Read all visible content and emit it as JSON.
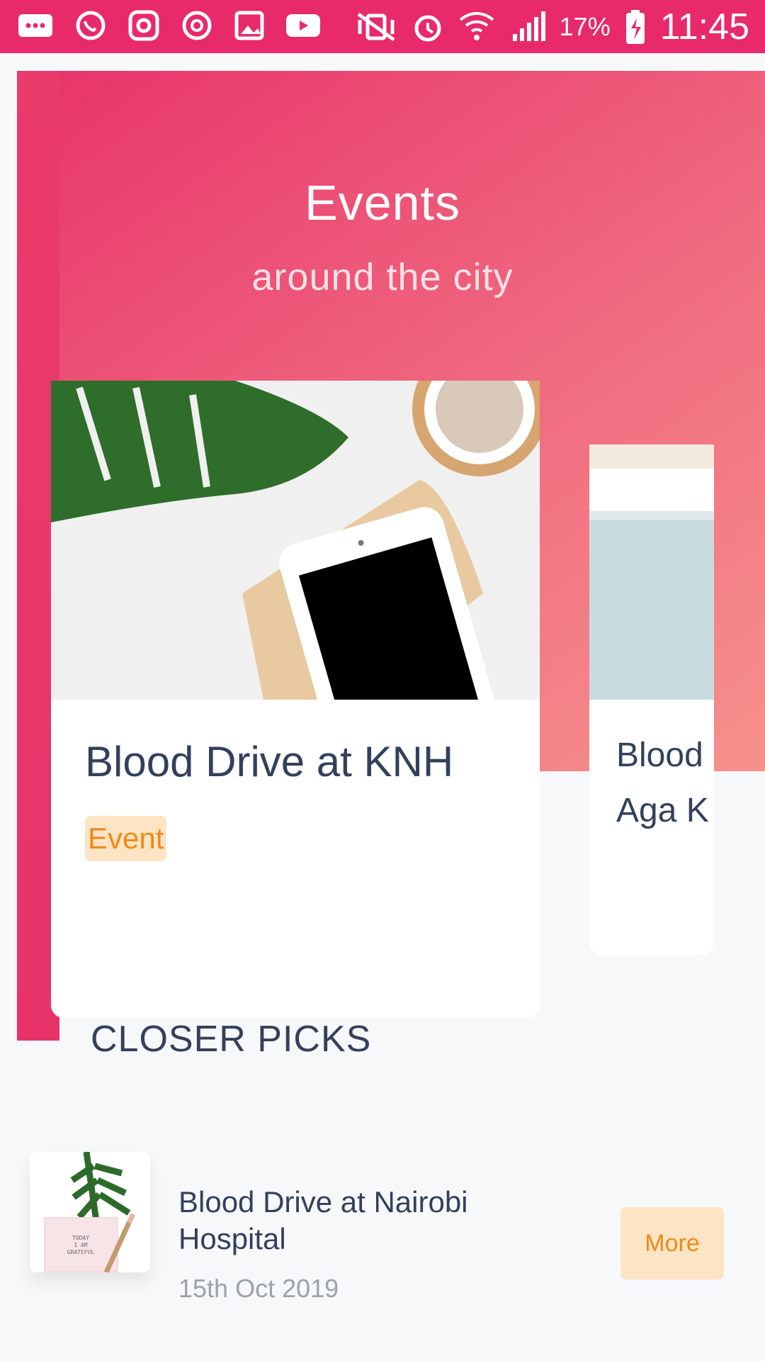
{
  "status_bar": {
    "battery_percent": "17%",
    "time": "11:45",
    "icons_left": [
      "messages-icon",
      "whatsapp-icon",
      "instagram-icon",
      "refresh-icon",
      "gallery-icon",
      "youtube-icon"
    ],
    "icons_right": [
      "vibrate-icon",
      "alarm-icon",
      "wifi-icon",
      "signal-icon",
      "battery-charging-icon"
    ]
  },
  "hero": {
    "title": "Events",
    "subtitle": "around the city"
  },
  "cards": [
    {
      "title": "Blood Drive at KNH",
      "badge": "Event"
    },
    {
      "title_line1": "Blood",
      "title_line2": "Aga K"
    }
  ],
  "section": {
    "title": "CLOSER PICKS"
  },
  "picks": [
    {
      "title": "Blood Drive at Nairobi Hospital",
      "date": "15th Oct 2019",
      "button": "More",
      "thumb_text": "TODAY I AM GRATEFUL"
    }
  ],
  "colors": {
    "accent_pink": "#e8296a",
    "text_primary": "#33405c",
    "badge_bg": "#fde4c5",
    "badge_text": "#f08a17"
  }
}
